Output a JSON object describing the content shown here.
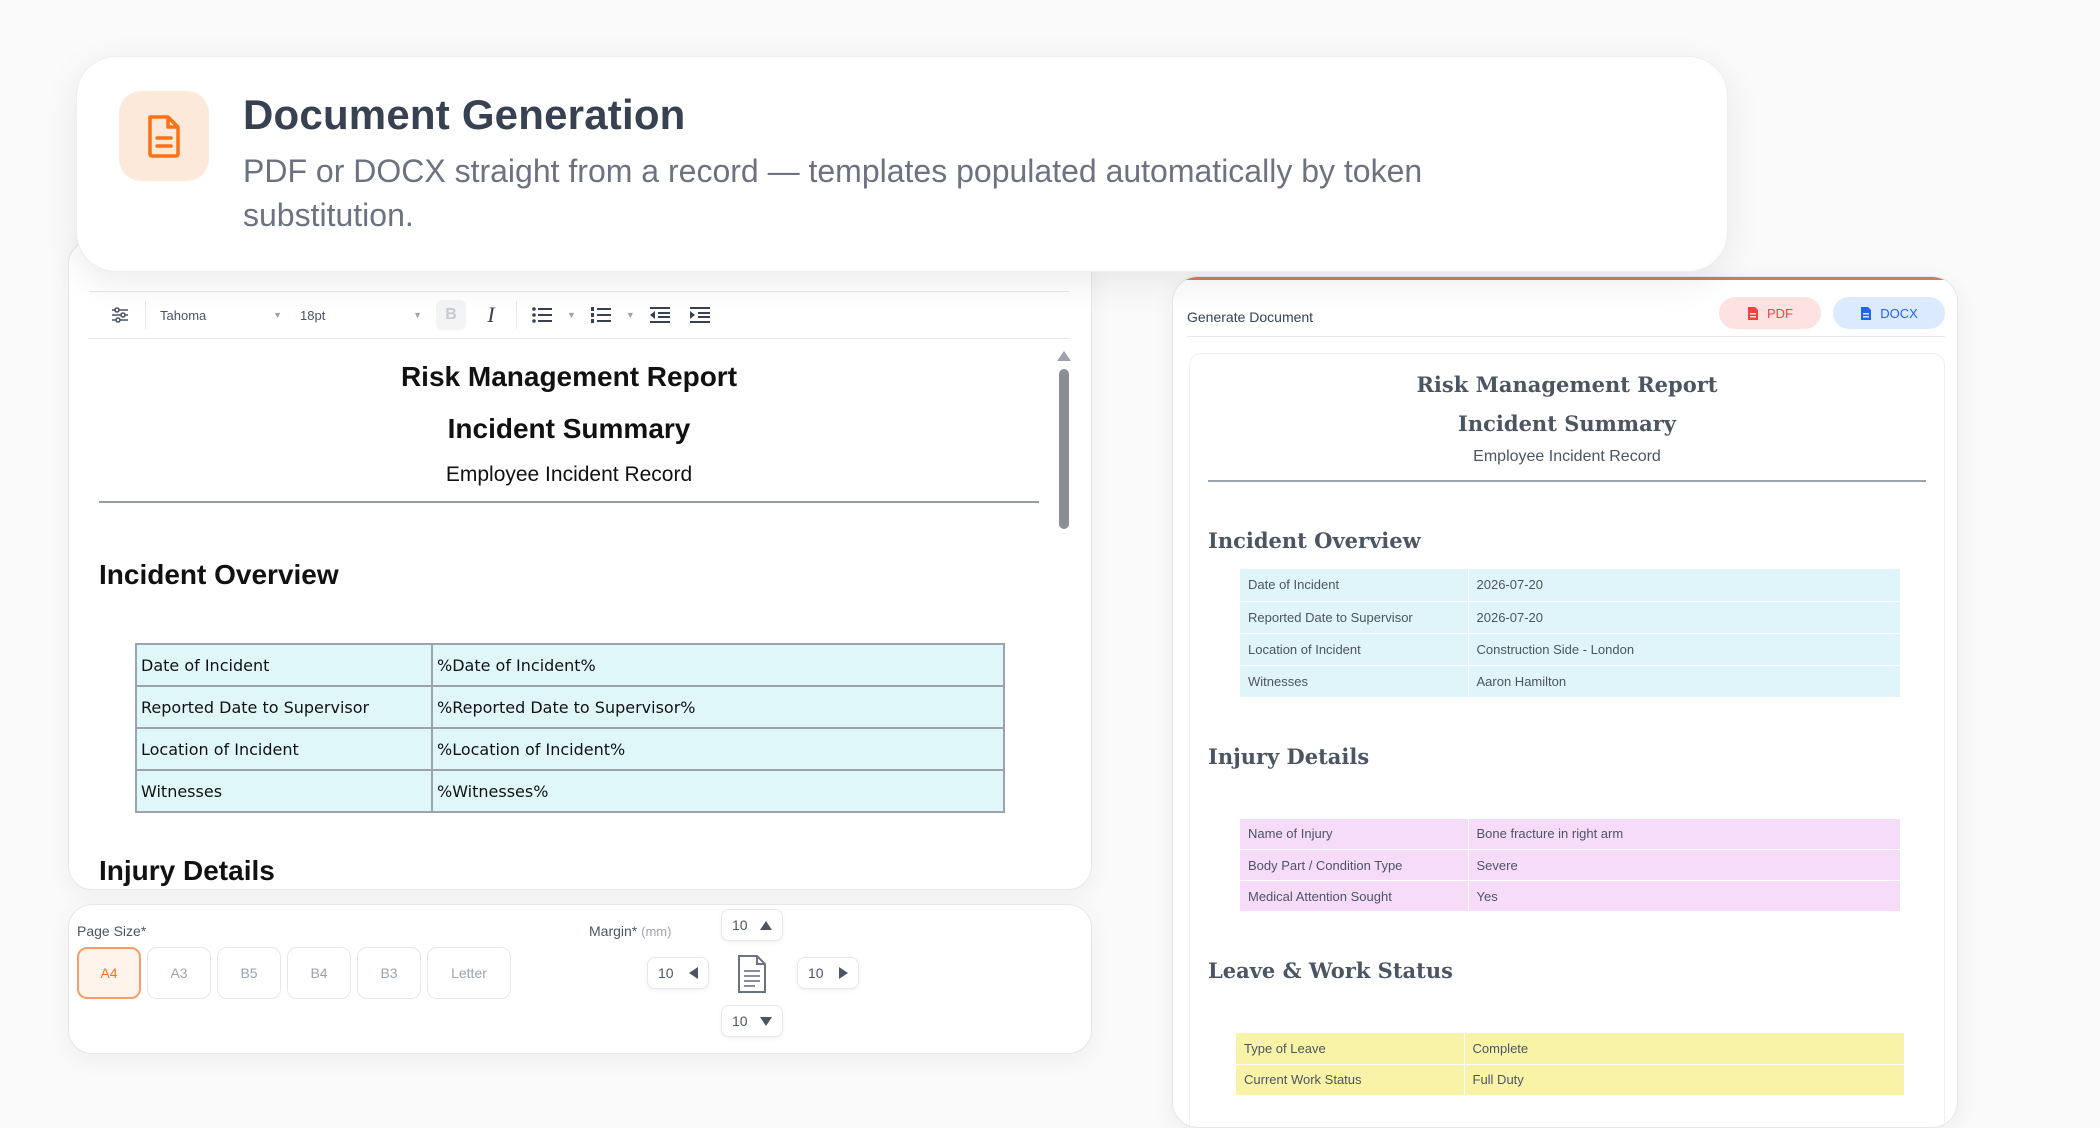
{
  "feature": {
    "title": "Document Generation",
    "description": "PDF or DOCX straight from a record — templates populated automatically by token substitution.",
    "icon": "document-icon",
    "accent": "#f97316"
  },
  "editor": {
    "toolbar": {
      "font": "Tahoma",
      "size": "18pt",
      "bold": "B",
      "italic": "I"
    },
    "document": {
      "title": "Risk Management Report",
      "subtitle": "Incident Summary",
      "record": "Employee Incident Record",
      "section1": "Incident Overview",
      "rows": [
        {
          "label": "Date of Incident",
          "token": "%Date of Incident%"
        },
        {
          "label": "Reported Date to Supervisor",
          "token": "%Reported Date to Supervisor%"
        },
        {
          "label": "Location of Incident",
          "token": "%Location of Incident%"
        },
        {
          "label": "Witnesses",
          "token": "%Witnesses%"
        }
      ],
      "section2": "Injury Details"
    }
  },
  "settings": {
    "page_size_label": "Page Size*",
    "page_sizes": [
      "A4",
      "A3",
      "B5",
      "B4",
      "B3",
      "Letter"
    ],
    "selected_page_size": "A4",
    "margin_label": "Margin*",
    "margin_unit": "(mm)",
    "margins": {
      "top": "10",
      "left": "10",
      "right": "10",
      "bottom": "10"
    }
  },
  "preview": {
    "header_title": "Generate Document",
    "pdf_label": "PDF",
    "docx_label": "DOCX",
    "title": "Risk Management Report",
    "subtitle": "Incident Summary",
    "record": "Employee Incident Record",
    "sections": [
      {
        "heading": "Incident Overview",
        "color": "#dff5f9",
        "rows": [
          {
            "label": "Date of Incident",
            "value": "2026-07-20"
          },
          {
            "label": "Reported Date to Supervisor",
            "value": "2026-07-20"
          },
          {
            "label": "Location of Incident",
            "value": "Construction Side - London"
          },
          {
            "label": "Witnesses",
            "value": "Aaron Hamilton"
          }
        ]
      },
      {
        "heading": "Injury Details",
        "color": "#f7dcf9",
        "rows": [
          {
            "label": "Name of Injury",
            "value": "Bone fracture in right arm"
          },
          {
            "label": "Body Part / Condition Type",
            "value": "Severe"
          },
          {
            "label": "Medical Attention Sought",
            "value": "Yes"
          }
        ]
      },
      {
        "heading": "Leave & Work Status",
        "color": "#f9f3a8",
        "rows": [
          {
            "label": "Type of Leave",
            "value": "Complete"
          },
          {
            "label": "Current Work Status",
            "value": "Full Duty"
          }
        ]
      }
    ]
  }
}
